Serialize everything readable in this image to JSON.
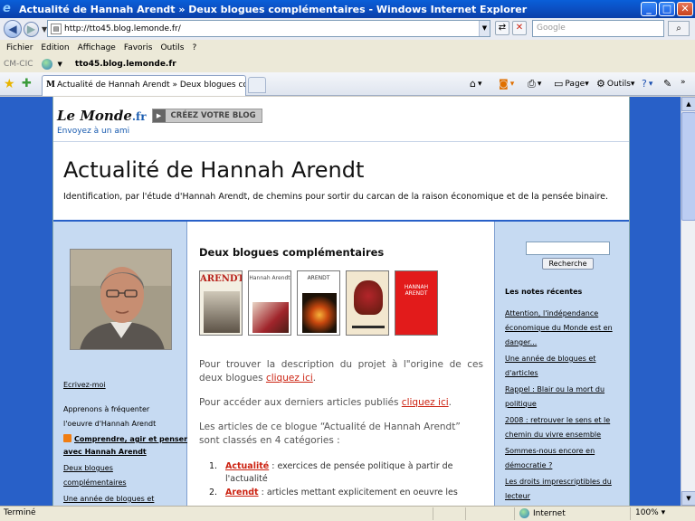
{
  "window": {
    "title": "Actualité de Hannah Arendt » Deux blogues complémentaires - Windows Internet Explorer"
  },
  "addressbar": {
    "url": "http://tto45.blog.lemonde.fr/",
    "search_placeholder": "Google"
  },
  "menu": {
    "items": [
      "Fichier",
      "Edition",
      "Affichage",
      "Favoris",
      "Outils",
      "?"
    ]
  },
  "linksbar": {
    "label": "CM-CIC",
    "link": "tto45.blog.lemonde.fr"
  },
  "tabs": {
    "active_label": "Actualité de Hannah Arendt » Deux blogues complém...",
    "commands": {
      "page": "Page",
      "tools": "Outils"
    }
  },
  "site_header": {
    "logo_main": "Le Monde",
    "logo_suffix": ".fr",
    "create_blog": "CRÉEZ VOTRE BLOG",
    "send_friend": "Envoyez à un ami",
    "blog_title": "Actualité de Hannah Arendt",
    "blog_description": "Identification, par l'étude d'Hannah Arendt, de chemins pour sortir du carcan de la raison économique et de la pensée binaire."
  },
  "left_sidebar": {
    "links": [
      "Ecrivez-moi",
      "Apprenons à fréquenter",
      "l'oeuvre d'Hannah Arendt",
      "Comprendre, agir et penser",
      "avec Hannah Arendt",
      "Deux blogues",
      "complémentaires",
      "Une année de blogues et"
    ]
  },
  "right_sidebar": {
    "search_button": "Recherche",
    "recent_heading": "Les notes récentes",
    "recent_items": [
      "Attention, l'indépendance économique du Monde est en danger...",
      "Une année de blogues et d'articles",
      "Rappel : Blair ou la mort du politique",
      "2008 : retrouver le sens et le chemin du vivre ensemble",
      "Sommes-nous encore en démocratie ?",
      "Les droits imprescriptibles du lecteur"
    ]
  },
  "post": {
    "title": "Deux blogues complémentaires",
    "books": {
      "book1_title": "ARENDT",
      "book2_title": "Hannah Arendt",
      "book3_title": "ARENDT",
      "book5_title": "HANNAH ARENDT"
    },
    "p1_text": "Pour trouver la description du projet à l\"origine de ces deux blogues ",
    "p1_link": "cliquez ici",
    "p1_end": ".",
    "p2_text": "Pour accéder aux derniers articles publiés ",
    "p2_link": "cliquez ici",
    "p2_end": ".",
    "p3_line1": " Les articles de ce blogue “Actualité de Hannah Arendt”",
    "p3_line2": "sont classés en 4 catégories :",
    "categories": [
      {
        "num": "1.",
        "name": "Actualité",
        "text": " :   exercices de pensée politique à partir de l'actualité"
      },
      {
        "num": "2.",
        "name": "Arendt",
        "text": " :   articles mettant explicitement en oeuvre les"
      }
    ]
  },
  "statusbar": {
    "text": "Terminé",
    "zone": "Internet",
    "zoom": "100%"
  }
}
